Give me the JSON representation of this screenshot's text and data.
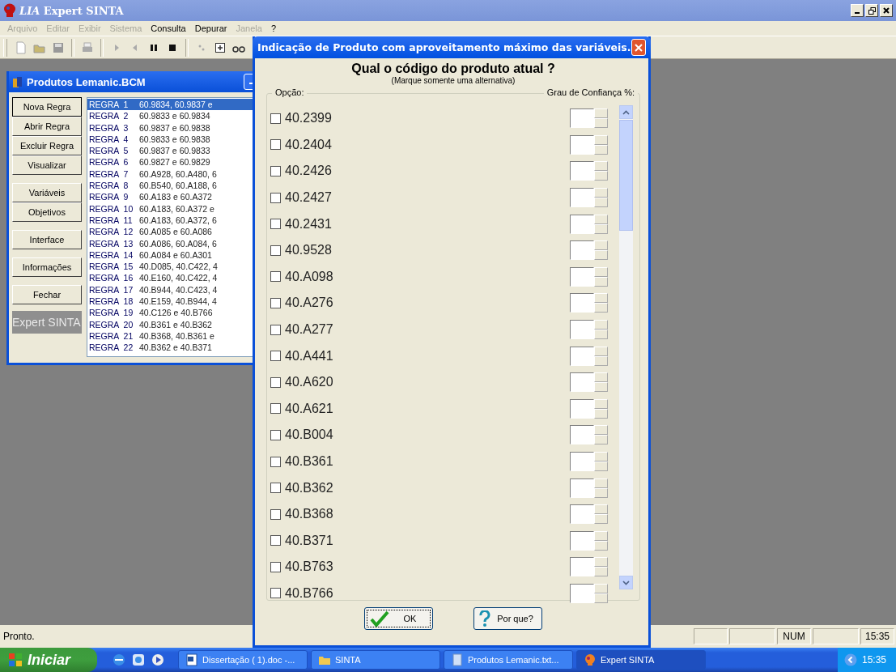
{
  "window": {
    "title": "*LIA* Expert SINTA"
  },
  "menu": [
    {
      "label": "Arquivo",
      "disabled": true
    },
    {
      "label": "Editar",
      "disabled": true
    },
    {
      "label": "Exibir",
      "disabled": true
    },
    {
      "label": "Sistema",
      "disabled": true
    },
    {
      "label": "Consulta",
      "disabled": false
    },
    {
      "label": "Depurar",
      "disabled": false
    },
    {
      "label": "Janela",
      "disabled": true
    },
    {
      "label": "?",
      "disabled": false
    }
  ],
  "child_window": {
    "title": "Produtos Lemanic.BCM",
    "logo": "Expert SINTA",
    "button_groups": [
      [
        {
          "label": "Nova Regra",
          "focused": true
        },
        {
          "label": "Abrir Regra",
          "focused": false
        },
        {
          "label": "Excluir Regra",
          "focused": false
        },
        {
          "label": "Visualizar",
          "focused": false
        }
      ],
      [
        {
          "label": "Variáveis",
          "focused": false
        },
        {
          "label": "Objetivos",
          "focused": false
        }
      ],
      [
        {
          "label": "Interface",
          "focused": false
        }
      ],
      [
        {
          "label": "Informações",
          "focused": false
        }
      ],
      [
        {
          "label": "Fechar",
          "focused": false
        }
      ]
    ],
    "rules": [
      {
        "name": "REGRA  1",
        "products": "60.9834, 60.9837 e",
        "selected": true
      },
      {
        "name": "REGRA  2",
        "products": "60.9833 e 60.9834",
        "selected": false
      },
      {
        "name": "REGRA  3",
        "products": "60.9837 e 60.9838",
        "selected": false
      },
      {
        "name": "REGRA  4",
        "products": "60.9833 e 60.9838",
        "selected": false
      },
      {
        "name": "REGRA  5",
        "products": "60.9837 e 60.9833",
        "selected": false
      },
      {
        "name": "REGRA  6",
        "products": "60.9827 e 60.9829",
        "selected": false
      },
      {
        "name": "REGRA  7",
        "products": "60.A928, 60.A480, 6",
        "selected": false
      },
      {
        "name": "REGRA  8",
        "products": "60.B540, 60.A188, 6",
        "selected": false
      },
      {
        "name": "REGRA  9",
        "products": "60.A183 e 60.A372",
        "selected": false
      },
      {
        "name": "REGRA  10",
        "products": "60.A183, 60.A372 e",
        "selected": false
      },
      {
        "name": "REGRA  11",
        "products": "60.A183, 60.A372, 6",
        "selected": false
      },
      {
        "name": "REGRA  12",
        "products": "60.A085 e 60.A086",
        "selected": false
      },
      {
        "name": "REGRA  13",
        "products": "60.A086, 60.A084, 6",
        "selected": false
      },
      {
        "name": "REGRA  14",
        "products": "60.A084 e 60.A301",
        "selected": false
      },
      {
        "name": "REGRA  15",
        "products": "40.D085, 40.C422, 4",
        "selected": false
      },
      {
        "name": "REGRA  16",
        "products": "40.E160, 40.C422, 4",
        "selected": false
      },
      {
        "name": "REGRA  17",
        "products": "40.B944, 40.C423, 4",
        "selected": false
      },
      {
        "name": "REGRA  18",
        "products": "40.E159, 40.B944, 4",
        "selected": false
      },
      {
        "name": "REGRA  19",
        "products": "40.C126 e 40.B766",
        "selected": false
      },
      {
        "name": "REGRA  20",
        "products": "40.B361 e 40.B362",
        "selected": false
      },
      {
        "name": "REGRA  21",
        "products": "40.B368, 40.B361 e",
        "selected": false
      },
      {
        "name": "REGRA  22",
        "products": "40.B362 e 40.B371",
        "selected": false
      }
    ]
  },
  "dialog": {
    "title": "Indicação de Produto com aproveitamento máximo das variáveis.",
    "question": "Qual o código do produto atual ?",
    "hint": "(Marque somente uma alternativa)",
    "option_label": "Opção:",
    "confidence_label": "Grau de Confiança %:",
    "options": [
      {
        "code": "40.2399",
        "checked": false
      },
      {
        "code": "40.2404",
        "checked": false
      },
      {
        "code": "40.2426",
        "checked": false
      },
      {
        "code": "40.2427",
        "checked": false
      },
      {
        "code": "40.2431",
        "checked": false
      },
      {
        "code": "40.9528",
        "checked": false
      },
      {
        "code": "40.A098",
        "checked": false
      },
      {
        "code": "40.A276",
        "checked": false
      },
      {
        "code": "40.A277",
        "checked": false
      },
      {
        "code": "40.A441",
        "checked": false
      },
      {
        "code": "40.A620",
        "checked": false
      },
      {
        "code": "40.A621",
        "checked": false
      },
      {
        "code": "40.B004",
        "checked": false
      },
      {
        "code": "40.B361",
        "checked": false
      },
      {
        "code": "40.B362",
        "checked": false
      },
      {
        "code": "40.B368",
        "checked": false
      },
      {
        "code": "40.B371",
        "checked": false
      },
      {
        "code": "40.B763",
        "checked": false
      },
      {
        "code": "40.B766",
        "checked": false
      }
    ],
    "buttons": [
      {
        "label": "OK",
        "kind": "ok",
        "focused": true
      },
      {
        "label": "Por que?",
        "kind": "help",
        "focused": false
      }
    ]
  },
  "status_bar": {
    "text": "Pronto.",
    "indicator": "NUM",
    "clock": "15:35"
  },
  "taskbar": {
    "start": "Iniciar",
    "tasks": [
      {
        "label": "Dissertação ( 1).doc -...",
        "kind": "document",
        "selected": false
      },
      {
        "label": "SINTA",
        "kind": "folder",
        "selected": false
      },
      {
        "label": "Produtos Lemanic.txt...",
        "kind": "text",
        "selected": false
      },
      {
        "label": "Expert SINTA",
        "kind": "app",
        "selected": true
      }
    ],
    "clock": "15:35"
  }
}
